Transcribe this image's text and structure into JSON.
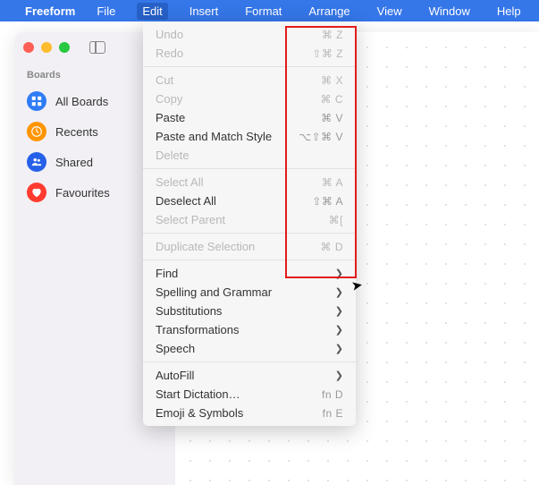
{
  "menubar": {
    "app_name": "Freeform",
    "items": [
      "File",
      "Edit",
      "Insert",
      "Format",
      "Arrange",
      "View",
      "Window",
      "Help"
    ],
    "active": "Edit"
  },
  "sidebar": {
    "header": "Boards",
    "items": [
      {
        "label": "All Boards",
        "icon": "grid",
        "color": "ic-blue"
      },
      {
        "label": "Recents",
        "icon": "clock",
        "color": "ic-orange"
      },
      {
        "label": "Shared",
        "icon": "people",
        "color": "ic-darkblue"
      },
      {
        "label": "Favourites",
        "icon": "heart",
        "color": "ic-red"
      }
    ]
  },
  "dropdown": {
    "groups": [
      [
        {
          "label": "Undo",
          "shortcut": "⌘ Z",
          "disabled": true
        },
        {
          "label": "Redo",
          "shortcut": "⇧⌘ Z",
          "disabled": true
        }
      ],
      [
        {
          "label": "Cut",
          "shortcut": "⌘ X",
          "disabled": true
        },
        {
          "label": "Copy",
          "shortcut": "⌘ C",
          "disabled": true
        },
        {
          "label": "Paste",
          "shortcut": "⌘ V",
          "disabled": false
        },
        {
          "label": "Paste and Match Style",
          "shortcut": "⌥⇧⌘ V",
          "disabled": false
        },
        {
          "label": "Delete",
          "shortcut": "",
          "disabled": true
        }
      ],
      [
        {
          "label": "Select All",
          "shortcut": "⌘ A",
          "disabled": true
        },
        {
          "label": "Deselect All",
          "shortcut": "⇧⌘ A",
          "disabled": false
        },
        {
          "label": "Select Parent",
          "shortcut": "⌘[",
          "disabled": true
        }
      ],
      [
        {
          "label": "Duplicate Selection",
          "shortcut": "⌘ D",
          "disabled": true
        }
      ],
      [
        {
          "label": "Find",
          "submenu": true,
          "disabled": false
        },
        {
          "label": "Spelling and Grammar",
          "submenu": true,
          "disabled": false
        },
        {
          "label": "Substitutions",
          "submenu": true,
          "disabled": false
        },
        {
          "label": "Transformations",
          "submenu": true,
          "disabled": false
        },
        {
          "label": "Speech",
          "submenu": true,
          "disabled": false
        }
      ],
      [
        {
          "label": "AutoFill",
          "submenu": true,
          "disabled": false
        },
        {
          "label": "Start Dictation…",
          "shortcut": "fn D",
          "disabled": false
        },
        {
          "label": "Emoji & Symbols",
          "shortcut": "fn E",
          "disabled": false
        }
      ]
    ]
  }
}
